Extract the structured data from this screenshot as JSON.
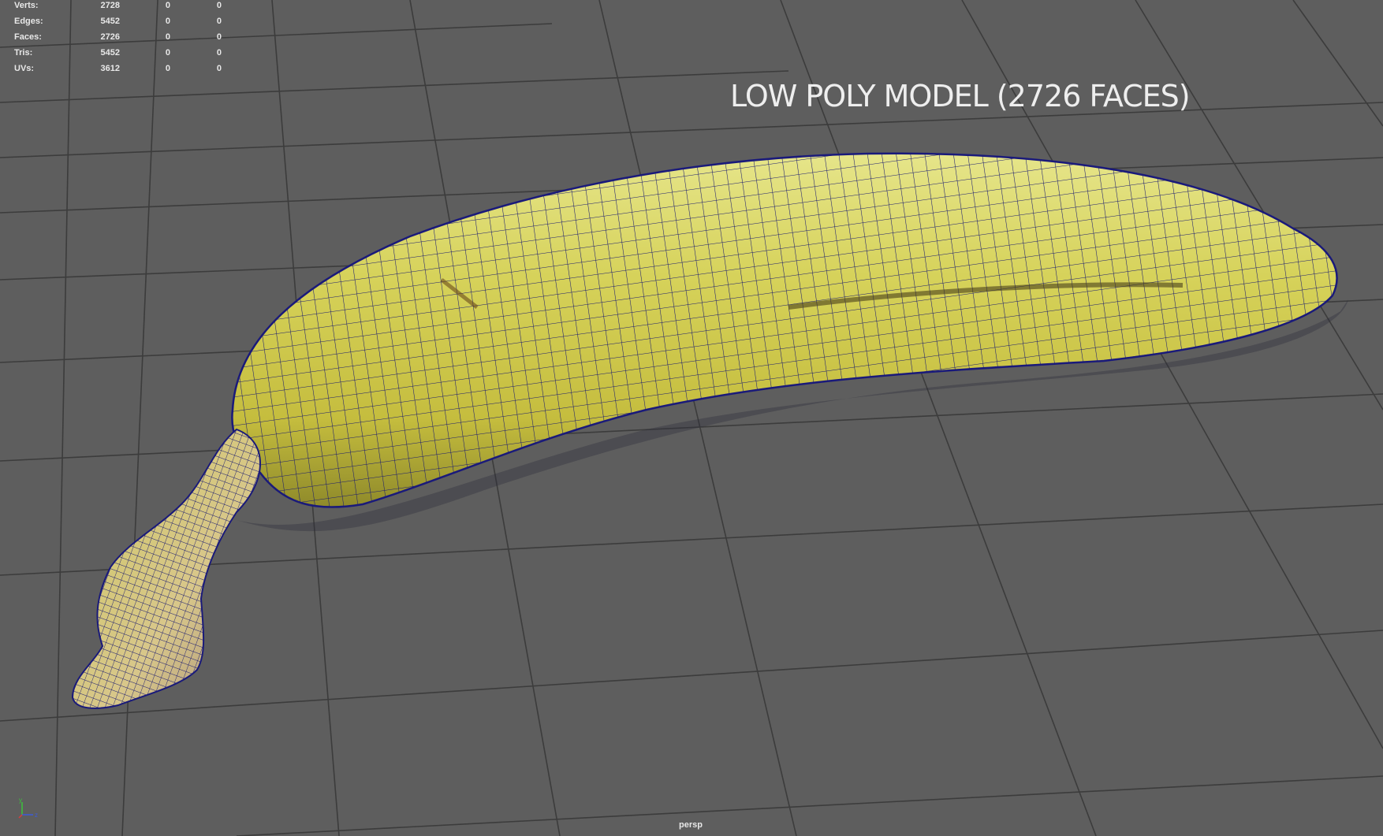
{
  "overlay_title": "LOW POLY MODEL (2726 FACES)",
  "camera": "persp",
  "stats": [
    {
      "label": "Verts:",
      "v1": "2728",
      "v2": "0",
      "v3": "0"
    },
    {
      "label": "Edges:",
      "v1": "5452",
      "v2": "0",
      "v3": "0"
    },
    {
      "label": "Faces:",
      "v1": "2726",
      "v2": "0",
      "v3": "0"
    },
    {
      "label": "Tris:",
      "v1": "5452",
      "v2": "0",
      "v3": "0"
    },
    {
      "label": "UVs:",
      "v1": "3612",
      "v2": "0",
      "v3": "0"
    }
  ],
  "axis": {
    "y": "y",
    "z": "z"
  },
  "colors": {
    "background": "#5e5e5e",
    "grid": "#3c3c3c",
    "wireframe": "#1a1a6e",
    "banana": "#d8d35a"
  }
}
